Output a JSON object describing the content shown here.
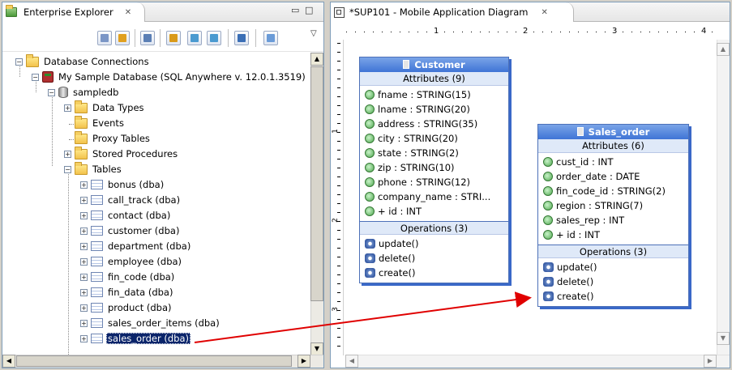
{
  "explorer": {
    "title": "Enterprise Explorer",
    "close_glyph": "✕",
    "minimize_glyph": "▭",
    "maximize_glyph": "□",
    "menu_glyph": "▽",
    "tree": {
      "root": "Database Connections",
      "connection": "My Sample Database (SQL Anywhere v. 12.0.1.3519)",
      "database": "sampledb",
      "folders": [
        "Data Types",
        "Events",
        "Proxy Tables",
        "Stored Procedures",
        "Tables"
      ],
      "tables": [
        "bonus (dba)",
        "call_track (dba)",
        "contact (dba)",
        "customer (dba)",
        "department (dba)",
        "employee (dba)",
        "fin_code (dba)",
        "fin_data (dba)",
        "product (dba)",
        "sales_order_items (dba)",
        "sales_order (dba)"
      ],
      "selected": "sales_order (dba)"
    }
  },
  "diagram": {
    "tab_title": "*SUP101 - Mobile Application Diagram",
    "close_glyph": "✕",
    "ruler_numbers": [
      "1",
      "2",
      "3",
      "4"
    ],
    "ruler_left_numbers": [
      "1",
      "2",
      "3"
    ],
    "customer": {
      "name": "Customer",
      "attributes_header": "Attributes (9)",
      "attributes": [
        "fname : STRING(15)",
        "lname : STRING(20)",
        "address : STRING(35)",
        "city : STRING(20)",
        "state : STRING(2)",
        "zip : STRING(10)",
        "phone : STRING(12)",
        "company_name : STRI...",
        "+ id : INT"
      ],
      "operations_header": "Operations (3)",
      "operations": [
        "update()",
        "delete()",
        "create()"
      ]
    },
    "sales_order": {
      "name": "Sales_order",
      "attributes_header": "Attributes (6)",
      "attributes": [
        "cust_id : INT",
        "order_date : DATE",
        "fin_code_id : STRING(2)",
        "region : STRING(7)",
        "sales_rep : INT",
        "+ id : INT"
      ],
      "operations_header": "Operations (3)",
      "operations": [
        "update()",
        "delete()",
        "create()"
      ]
    }
  },
  "colors": {
    "selection": "#0a246a",
    "class_header": "#3f74d6",
    "arrow": "#e00000"
  }
}
